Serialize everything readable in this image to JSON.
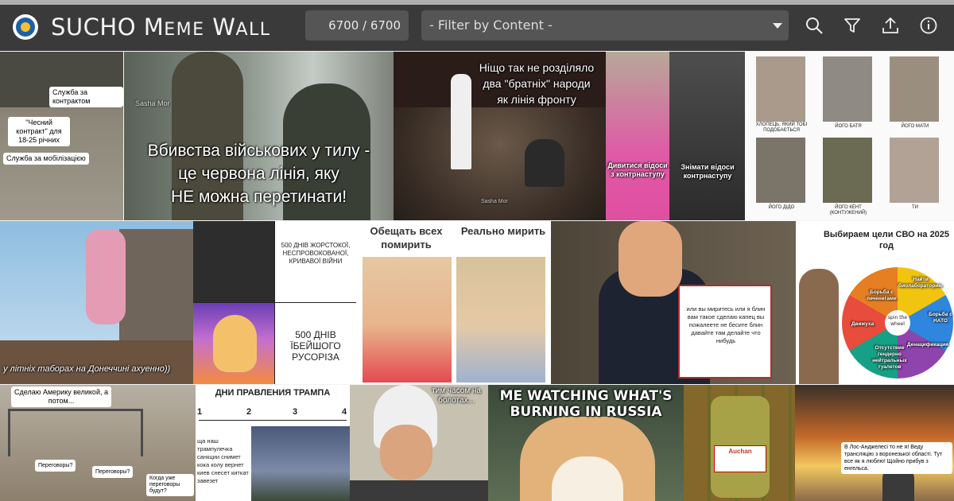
{
  "header": {
    "title_first": "SUCHO",
    "title_word1_initial": "M",
    "title_word1_rest": "EME",
    "title_word2_initial": "W",
    "title_word2_rest": "ALL",
    "counter": "6700 / 6700",
    "filter_placeholder": "- Filter by Content -",
    "icons": [
      "search-icon",
      "filter-icon",
      "upload-icon",
      "info-icon"
    ]
  },
  "memes": {
    "m1": {
      "bubbles": [
        "Служба за контрактом",
        "\"Чесний контракт\" для 18-25 річних",
        "Служба за мобілізацією"
      ]
    },
    "m2": {
      "watermark": "Sasha Mor",
      "line1": "Вбивства військових у тилу -",
      "line2": "це червона лінія, яку",
      "line3": "НЕ можна перетинати!"
    },
    "m3": {
      "line1": "Ніщо так не розділяло",
      "line2": "два \"братніх\" народи",
      "line3": "як лінія фронту",
      "watermark": "Sasha Mor"
    },
    "m4": {
      "left": "Дивитися відоси з контрнаступу",
      "right": "Знімати відоси контрнаступу"
    },
    "m5": {
      "captions": [
        "ХЛОПЕЦЬ, ЯКИЙ ТОБІ ПОДОБАЄТЬСЯ",
        "ЙОГО БАТЯ",
        "ЙОГО МАТИ",
        "ЙОГО ДІДО",
        "ЙОГО КЕНТ (КОНТУЖЕНИЙ)",
        "ТИ"
      ]
    },
    "m6": {
      "caption": "у літніх таборах на Донеччині ахуенно))"
    },
    "m7": {
      "top": "500 ДНІВ ЖОРСТОКОЇ, НЕСПРОВОКОВАНОЇ, КРИВАВОЇ ВІЙНИ",
      "bottom": "500 ДНІВ ЇБЕЙШОГО РУСОРІЗА"
    },
    "m8": {
      "left": "Обещать всех помирить",
      "right": "Реально мирить"
    },
    "m9": {
      "sign": "или вы миритесь или я блин вам такое сделаю капец вы пожалеете не бесите блин давайте там делайте что нибудь"
    },
    "m10": {
      "title": "Выбираем цели СВО на 2025 год",
      "center": "spin the wheel",
      "segments": [
        "Найти биолабораторию",
        "Борьба с НАТО",
        "Денацификация",
        "Отсутствие гендерно нейтральных туалетов",
        "Движуха",
        "Борьба с печенегами"
      ]
    },
    "m11": {
      "top": "Сделаю Америку великой, а потом...",
      "b1": "Переговоры?",
      "b2": "Переговоры?",
      "b3": "Когда уже переговоры будут?"
    },
    "m12": {
      "title": "ДНИ ПРАВЛЕНИЯ ТРАМПА",
      "ticks": [
        "1",
        "2",
        "3",
        "4"
      ],
      "text": "ща наш трампулечка санкции снимет кока колу вернет киев снесет киткат завезет"
    },
    "m13": {
      "caption": "тим часом на болотах..."
    },
    "m14": {
      "line1": "ME WATCHING WHAT'S",
      "line2": "BURNING IN RUSSIA"
    },
    "m15": {
      "brand": "Auchan"
    },
    "m16": {
      "caption": "В Лос-Анджелесі то не я! Веду трансляцію з воронезької області. Тут все як я люблю! Щойно прибув з енгельса."
    }
  },
  "colors": {
    "header_bg": "#3a3a3a",
    "header_border": "#b0b0b0",
    "input_bg": "#555555",
    "text": "#f4f4f4"
  }
}
